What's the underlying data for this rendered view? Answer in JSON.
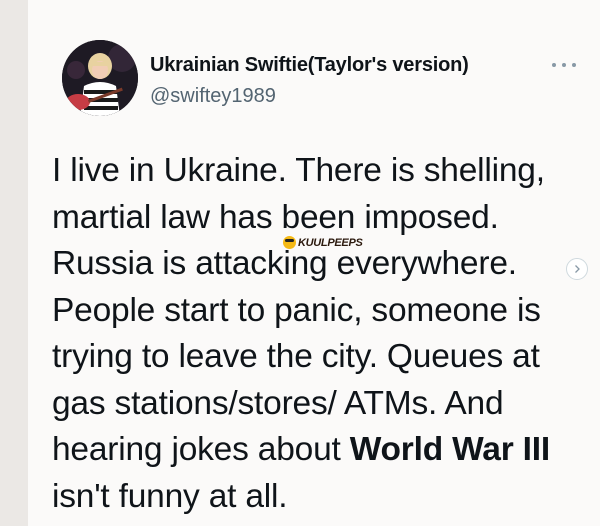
{
  "author": {
    "display_name": "Ukrainian Swiftie(Taylor's version)",
    "handle": "@swiftey1989"
  },
  "tweet": {
    "lines": [
      "I live in Ukraine. There is shelling,",
      "martial law has been imposed.",
      "Russia is attacking everywhere.",
      "People start to panic, someone is",
      "trying to leave the city. Queues at",
      "gas stations/stores/ ATMs. And",
      "hearing jokes about ",
      "isn't funny at all."
    ],
    "bold_phrase": "World War III"
  },
  "watermark": {
    "text": "KUULPEEPS"
  },
  "icons": {
    "more": "more-horizontal-icon",
    "next": "chevron-right-icon"
  },
  "colors": {
    "text": "#0f1419",
    "secondary": "#536471"
  }
}
